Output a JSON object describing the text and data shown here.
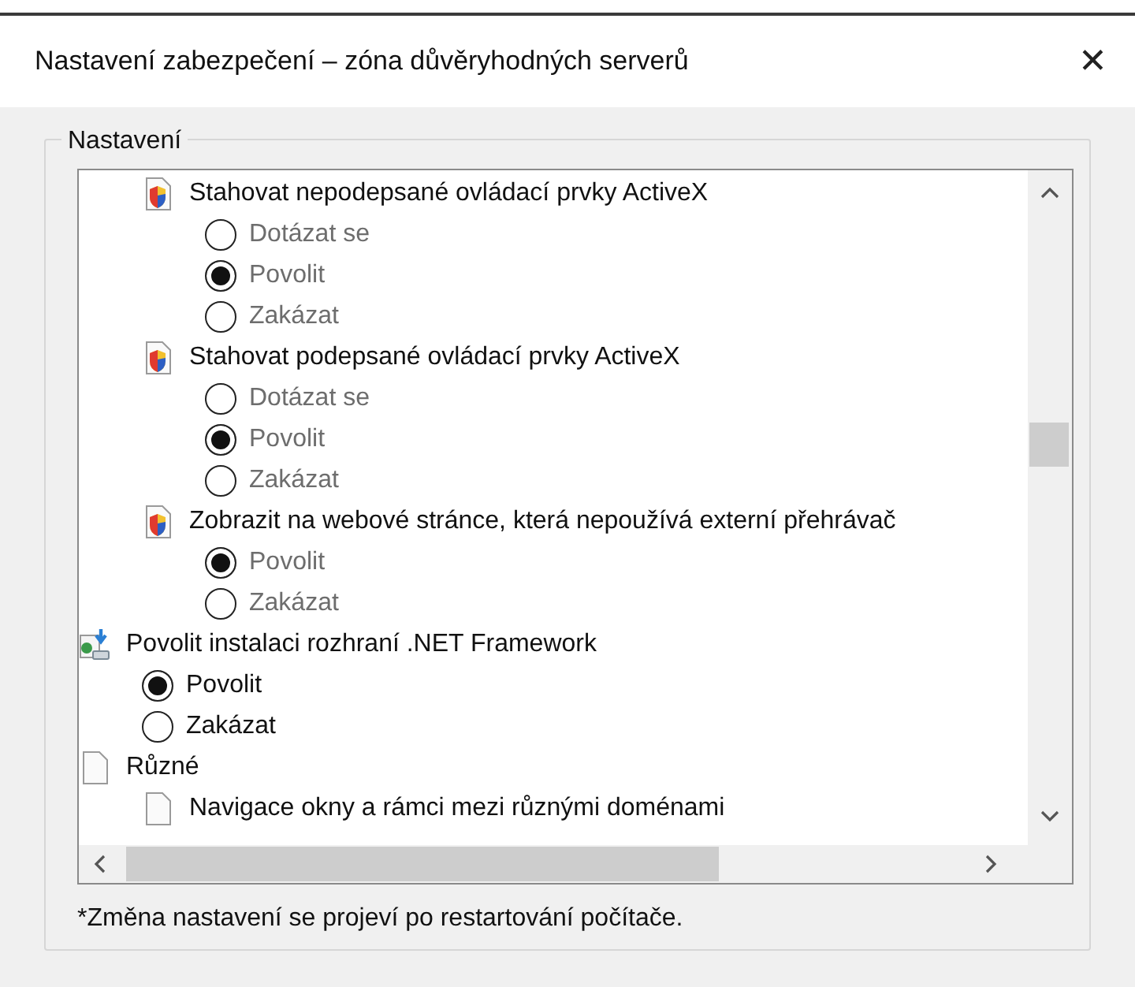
{
  "window": {
    "title": "Nastavení zabezpečení – zóna důvěryhodných serverů",
    "close": "✕"
  },
  "group": {
    "label": "Nastavení"
  },
  "tree": [
    {
      "children": [
        {
          "kind": "activex",
          "label": "Stahovat nepodepsané ovládací prvky ActiveX",
          "options": [
            {
              "label": "Dotázat se",
              "selected": false,
              "disabled": true
            },
            {
              "label": "Povolit",
              "selected": true,
              "disabled": true
            },
            {
              "label": "Zakázat",
              "selected": false,
              "disabled": true
            }
          ]
        },
        {
          "kind": "activex",
          "label": "Stahovat podepsané ovládací prvky ActiveX",
          "options": [
            {
              "label": "Dotázat se",
              "selected": false,
              "disabled": true
            },
            {
              "label": "Povolit",
              "selected": true,
              "disabled": true
            },
            {
              "label": "Zakázat",
              "selected": false,
              "disabled": true
            }
          ]
        },
        {
          "kind": "activex",
          "label": "Zobrazit na webové stránce, která nepoužívá externí přehrávač",
          "options": [
            {
              "label": "Povolit",
              "selected": true,
              "disabled": true
            },
            {
              "label": "Zakázat",
              "selected": false,
              "disabled": true
            }
          ]
        }
      ]
    },
    {
      "kind": "install",
      "label": "Povolit instalaci rozhraní .NET Framework",
      "options": [
        {
          "label": "Povolit",
          "selected": true,
          "disabled": false
        },
        {
          "label": "Zakázat",
          "selected": false,
          "disabled": false
        }
      ]
    },
    {
      "kind": "page",
      "label": "Různé",
      "children": [
        {
          "kind": "page",
          "label": "Navigace okny a rámci mezi různými doménami"
        }
      ]
    }
  ],
  "note": "*Změna nastavení se projeví po restartování počítače."
}
